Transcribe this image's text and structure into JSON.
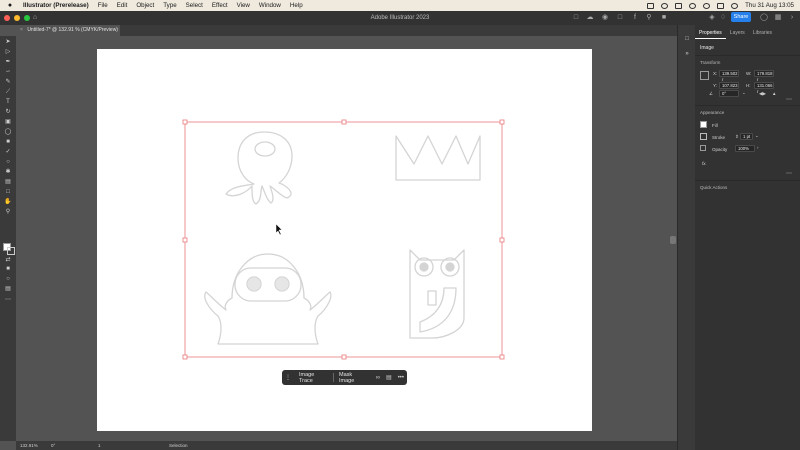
{
  "menubar": {
    "app_name": "Illustrator (Prerelease)",
    "items": [
      "File",
      "Edit",
      "Object",
      "Type",
      "Select",
      "Effect",
      "View",
      "Window",
      "Help"
    ],
    "clock": "Thu 31 Aug  13:05"
  },
  "appbar": {
    "title": "Adobe Illustrator 2023",
    "share_label": "Share"
  },
  "document": {
    "tab_title": "Untitled-7* @ 132.91 % (CMYK/Preview)",
    "tab_close": "×"
  },
  "taskbar": {
    "image_trace": "Image Trace",
    "mask_image": "Mask Image",
    "more": "•••"
  },
  "statusbar": {
    "zoom": "132.91%",
    "rotation": "0°",
    "artboard_number": "1",
    "tool": "Selection"
  },
  "panel": {
    "tabs": [
      "Properties",
      "Layers",
      "Libraries"
    ],
    "selection_type": "Image",
    "transform_heading": "Transform",
    "x_label": "X:",
    "x_value": "139.502 r",
    "w_label": "W:",
    "w_value": "179.818 r",
    "y_label": "Y:",
    "y_value": "107.823 r",
    "h_label": "H:",
    "h_value": "131.066 r",
    "angle_value": "0°",
    "appearance_heading": "Appearance",
    "fill_label": "Fill",
    "stroke_label": "Stroke",
    "stroke_value": "1 pt",
    "opacity_label": "Opacity",
    "opacity_value": "100%",
    "fx_label": "fx.",
    "quick_actions_heading": "Quick Actions"
  },
  "colors": {
    "selection_box": "#e8787a",
    "art_stroke": "#d4d4d4",
    "share_button": "#2680eb",
    "traffic_close": "#fe5f57",
    "traffic_min": "#febc2e",
    "traffic_max": "#28c840"
  }
}
